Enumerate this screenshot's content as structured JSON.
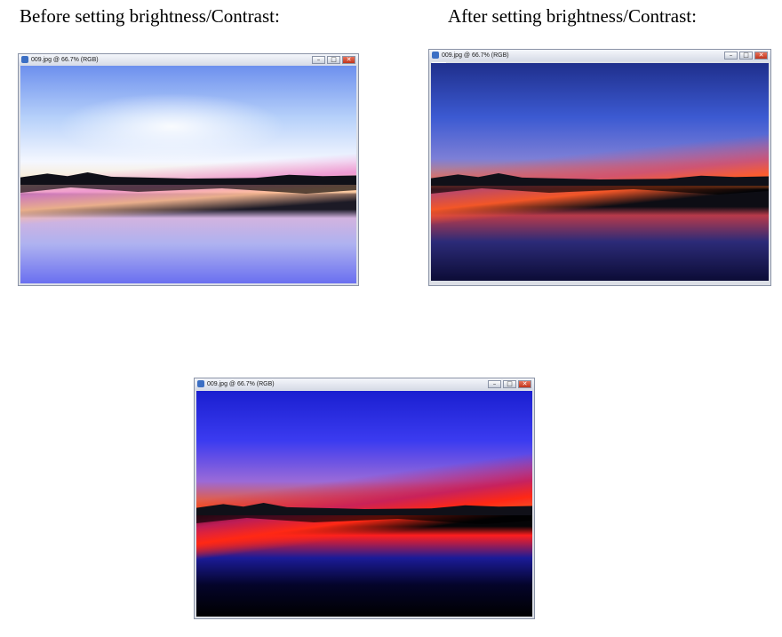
{
  "captions": {
    "before": "Before setting brightness/Contrast:",
    "after": "After setting brightness/Contrast:"
  },
  "windows": {
    "before": {
      "title": "009.jpg @ 66.7% (RGB)"
    },
    "after": {
      "title": "009.jpg @ 66.7% (RGB)"
    },
    "third": {
      "title": "009.jpg @ 66.7% (RGB)"
    }
  },
  "window_buttons": {
    "minimize": "–",
    "maximize": "□",
    "close": "✕"
  }
}
